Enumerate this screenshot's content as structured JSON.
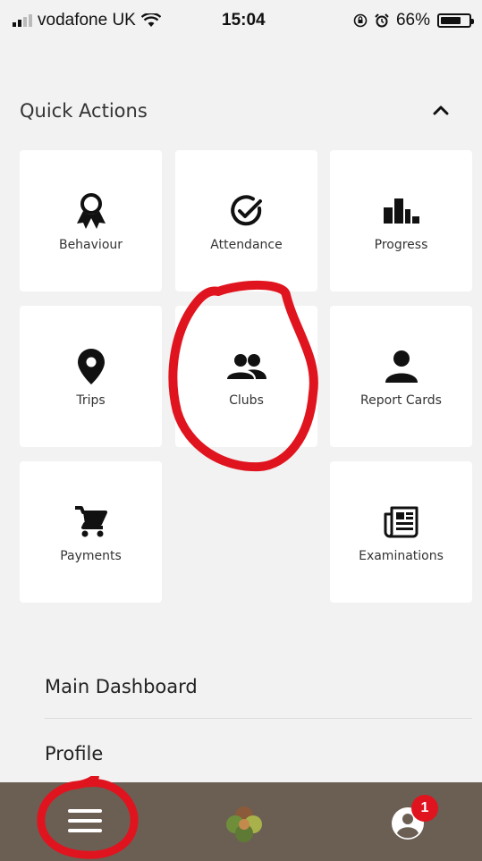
{
  "status_bar": {
    "carrier": "vodafone UK",
    "time": "15:04",
    "battery_percent": "66%",
    "battery_level": 0.66
  },
  "quick_actions": {
    "title": "Quick Actions",
    "toggle_icon": "chevron-up-icon",
    "tiles": [
      {
        "label": "Behaviour",
        "icon": "award-icon"
      },
      {
        "label": "Attendance",
        "icon": "check-circle-icon"
      },
      {
        "label": "Progress",
        "icon": "bar-chart-icon"
      },
      {
        "label": "Trips",
        "icon": "location-pin-icon"
      },
      {
        "label": "Clubs",
        "icon": "people-icon"
      },
      {
        "label": "Report Cards",
        "icon": "person-icon"
      },
      {
        "label": "Payments",
        "icon": "cart-icon"
      },
      {
        "label": "Examinations",
        "icon": "newspaper-icon"
      }
    ]
  },
  "menu": {
    "items": [
      {
        "label": "Main Dashboard"
      },
      {
        "label": "Profile"
      }
    ]
  },
  "bottom_nav": {
    "notification_count": "1",
    "background": "#6b5f54",
    "badge_color": "#e0141e"
  },
  "annotation_color": "#e0141e"
}
